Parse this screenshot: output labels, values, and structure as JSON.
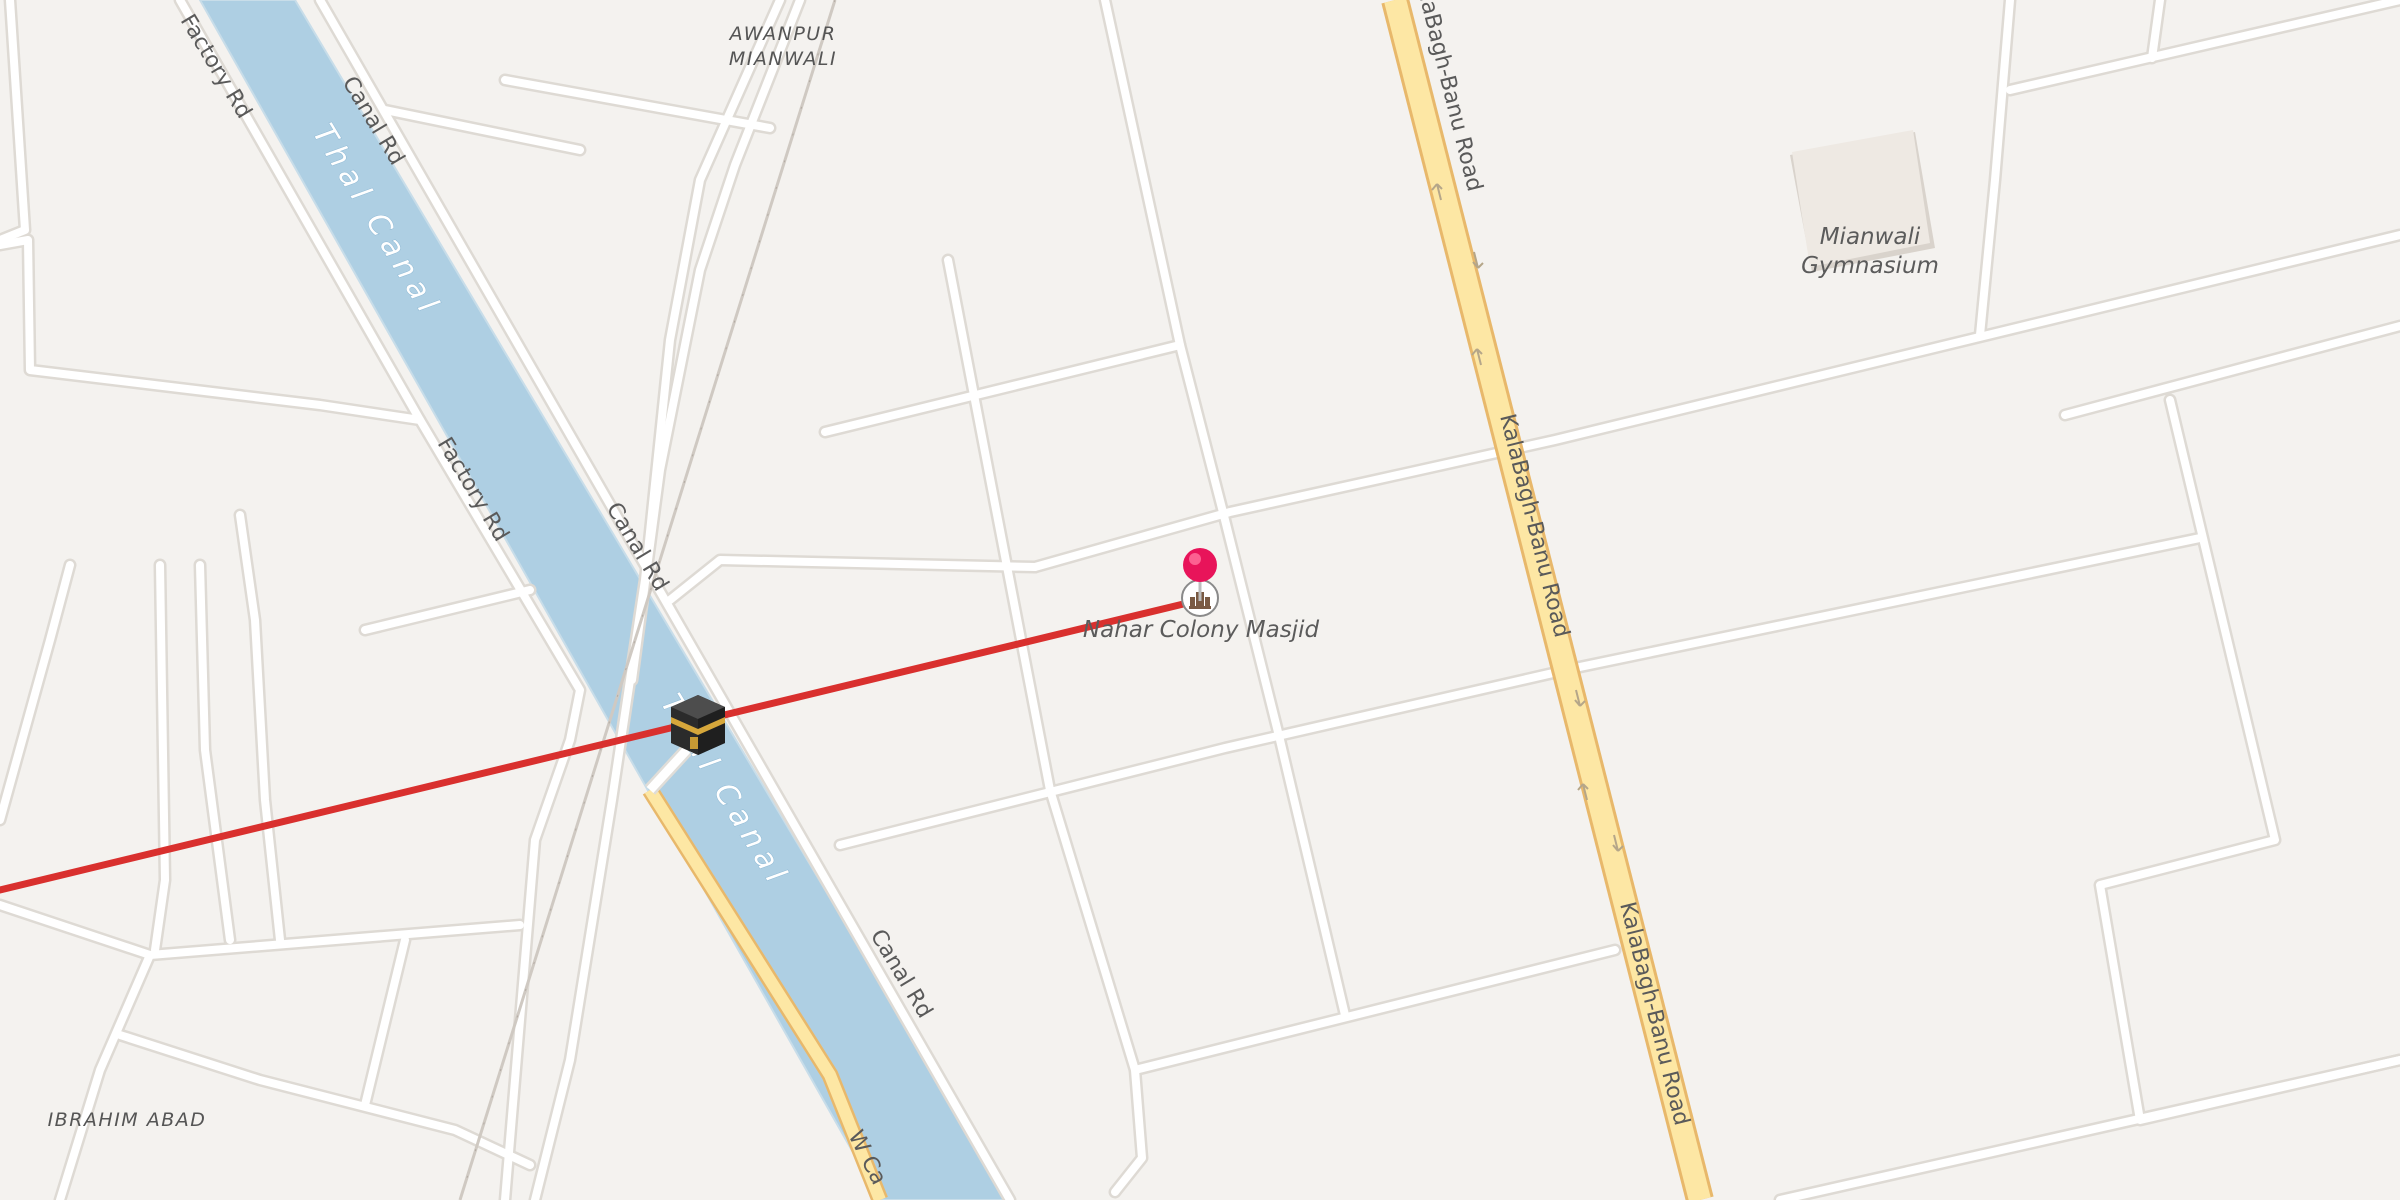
{
  "map": {
    "labels": {
      "thal_canal_1": "Thal Canal",
      "thal_canal_2": "Thal Canal",
      "factory_rd_1": "Factory Rd",
      "factory_rd_2": "Factory Rd",
      "canal_rd_1": "Canal Rd",
      "canal_rd_2": "Canal Rd",
      "canal_rd_3": "Canal Rd",
      "kalabagh_1": "KalaBagh-Banu Road",
      "kalabagh_2": "KalaBagh-Banu Road",
      "kalabagh_3": "KalaBagh-Banu Road",
      "w_canal": "W Ca",
      "awanpur_line1": "AWANPUR",
      "awanpur_line2": "MIANWALI",
      "ibrahim_abad": "IBRAHIM ABAD",
      "gymnasium_line1": "Mianwali",
      "gymnasium_line2": "Gymnasium",
      "masjid": "Nahar Colony Masjid"
    },
    "icons": {
      "kaaba": "kaaba-icon",
      "pin": "map-pin-icon",
      "mosque": "mosque-icon"
    },
    "colors": {
      "background": "#f4f2ef",
      "water": "#aecfe3",
      "road": "#ffffff",
      "road_casing": "#dedad4",
      "major_road": "#fde7a4",
      "major_road_casing": "#e8b86b",
      "route_line": "#d9302e",
      "pin": "#e8145a",
      "building": "#eee9e3"
    }
  }
}
